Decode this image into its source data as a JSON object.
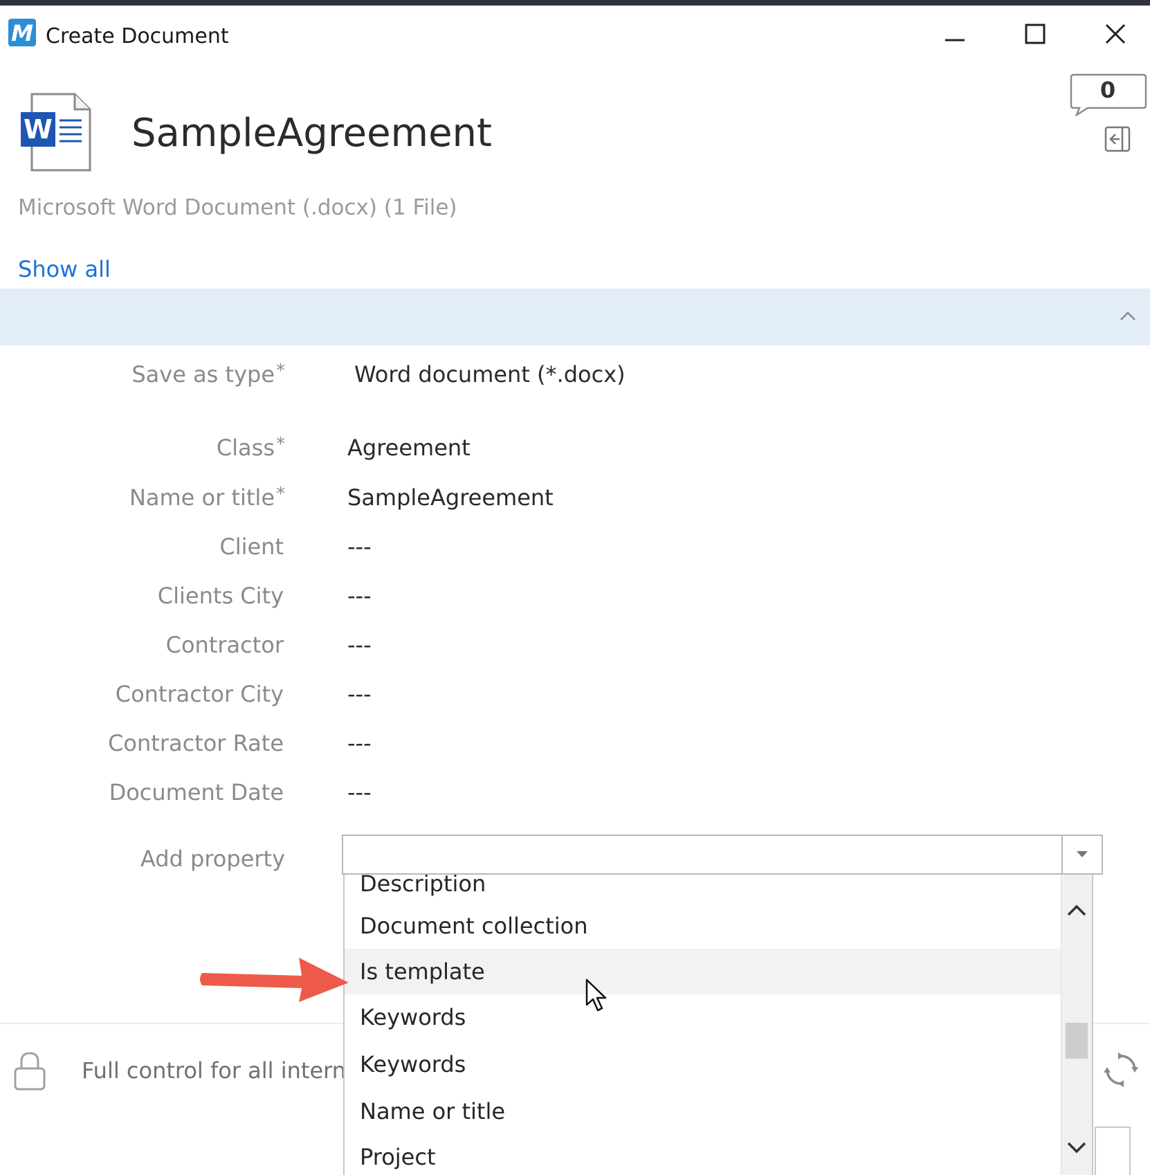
{
  "window": {
    "app_logo_letter": "M",
    "title": "Create Document",
    "controls": [
      "minimize",
      "maximize",
      "close"
    ]
  },
  "document": {
    "icon_letter": "W",
    "title": "SampleAgreement",
    "subtitle": "Microsoft Word Document (.docx) (1 File)",
    "comment_count": "0"
  },
  "links": {
    "show_all": "Show all"
  },
  "properties": [
    {
      "label": "Save as type",
      "required": "*",
      "value": "Word document (*.docx)"
    },
    {
      "label": "Class",
      "required": "*",
      "value": "Agreement"
    },
    {
      "label": "Name or title",
      "required": "*",
      "value": "SampleAgreement"
    },
    {
      "label": "Client",
      "required": "",
      "value": "---"
    },
    {
      "label": "Clients City",
      "required": "",
      "value": "---"
    },
    {
      "label": "Contractor",
      "required": "",
      "value": "---"
    },
    {
      "label": "Contractor City",
      "required": "",
      "value": "---"
    },
    {
      "label": "Contractor Rate",
      "required": "",
      "value": "---"
    },
    {
      "label": "Document Date",
      "required": "",
      "value": "---"
    }
  ],
  "add_property": {
    "label": "Add property",
    "value": "",
    "options": [
      "Description",
      "Document collection",
      "Is template",
      "Keywords",
      "Keywords",
      "Name or title",
      "Project"
    ],
    "hovered_option": "Is template"
  },
  "footer": {
    "permissions_text": "Full control for all internal"
  },
  "colors": {
    "accent_link": "#1a73d8",
    "section_band": "#e3edf7",
    "annotation_arrow": "#ee5a4a",
    "word_blue": "#1e56b3"
  },
  "icons": {
    "app": "m-files-logo-icon",
    "document": "word-document-icon",
    "comments": "comment-bubble-icon",
    "panel": "panel-toggle-icon",
    "collapse": "chevron-up-icon",
    "lock": "lock-icon",
    "refresh": "refresh-icon"
  }
}
